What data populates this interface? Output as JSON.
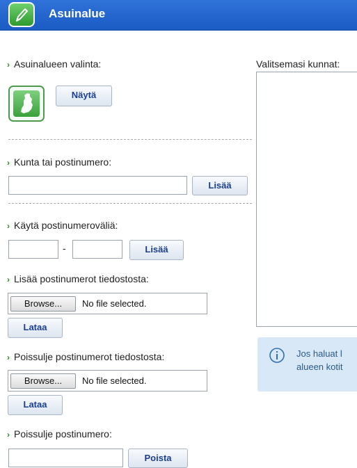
{
  "header": {
    "title": "Asuinalue",
    "icon": "pencil-icon"
  },
  "area_selection": {
    "label": "Asuinalueen valinta:",
    "map_icon": "finland-map-icon",
    "show_button": "Näytä"
  },
  "municipality": {
    "label": "Kunta tai postinumero:",
    "value": "",
    "add_button": "Lisää"
  },
  "postal_range": {
    "label": "Käytä postinumeroväliä:",
    "from_value": "",
    "separator": "-",
    "to_value": "",
    "add_button": "Lisää"
  },
  "add_from_file": {
    "label": "Lisää postinumerot tiedostosta:",
    "browse_button": "Browse...",
    "file_status": "No file selected.",
    "upload_button": "Lataa"
  },
  "exclude_from_file": {
    "label": "Poissulje postinumerot tiedostosta:",
    "browse_button": "Browse...",
    "file_status": "No file selected.",
    "upload_button": "Lataa"
  },
  "exclude_postal": {
    "label": "Poissulje postinumero:",
    "value": "",
    "remove_button": "Poista"
  },
  "selected": {
    "label": "Valitsemasi kunnat:",
    "items": []
  },
  "info": {
    "icon": "info-icon",
    "line1": "Jos haluat l",
    "line2": "alueen kotit"
  },
  "colors": {
    "header": "#1f62cc",
    "accent": "#2a8a2a",
    "button_text": "#1a3f8f",
    "info_bg": "#d8e8f7"
  }
}
